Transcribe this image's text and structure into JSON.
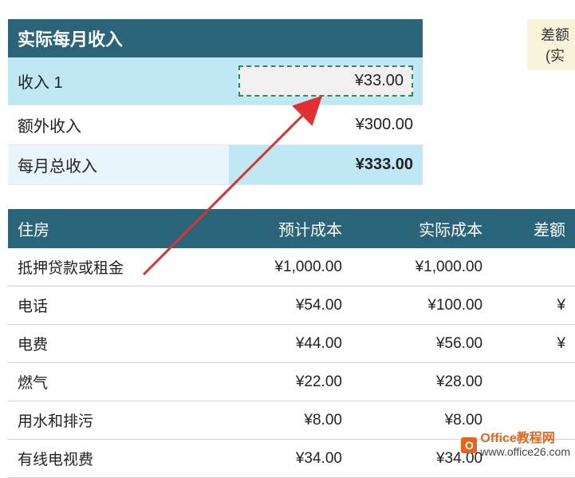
{
  "top_badge": {
    "line1": "差额",
    "line2": "(实"
  },
  "income": {
    "header": "实际每月收入",
    "rows": [
      {
        "label": "收入 1",
        "value": "¥33.00"
      },
      {
        "label": "额外收入",
        "value": "¥300.00"
      },
      {
        "label": "每月总收入",
        "value": "¥333.00"
      }
    ]
  },
  "housing": {
    "headers": {
      "item": "住房",
      "estimated": "预计成本",
      "actual": "实际成本",
      "diff": "差额"
    },
    "rows": [
      {
        "item": "抵押贷款或租金",
        "estimated": "¥1,000.00",
        "actual": "¥1,000.00",
        "diff": ""
      },
      {
        "item": "电话",
        "estimated": "¥54.00",
        "actual": "¥100.00",
        "diff": "¥"
      },
      {
        "item": "电费",
        "estimated": "¥44.00",
        "actual": "¥56.00",
        "diff": "¥"
      },
      {
        "item": "燃气",
        "estimated": "¥22.00",
        "actual": "¥28.00",
        "diff": ""
      },
      {
        "item": "用水和排污",
        "estimated": "¥8.00",
        "actual": "¥8.00",
        "diff": ""
      },
      {
        "item": "有线电视费",
        "estimated": "¥34.00",
        "actual": "¥34.00",
        "diff": ""
      }
    ]
  },
  "watermark": {
    "brand": "Office教程网",
    "url": "www.office26.com",
    "logo_letter": "O"
  }
}
